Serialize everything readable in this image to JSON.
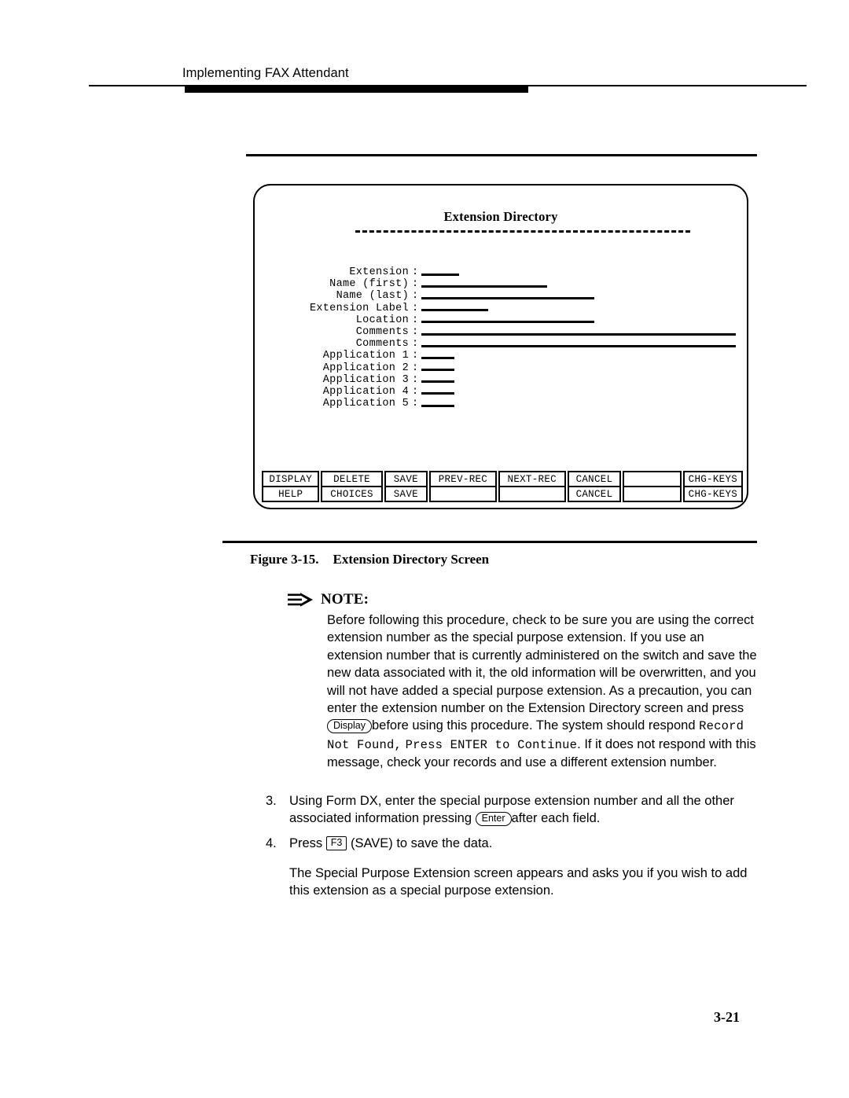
{
  "header": {
    "running_title": "Implementing FAX Attendant"
  },
  "figure": {
    "screen": {
      "title": "Extension Directory",
      "fields": [
        {
          "label": "Extension",
          "colon": ":",
          "line_width": 48
        },
        {
          "label": "Name (first)",
          "colon": ":",
          "line_width": 160
        },
        {
          "label": "Name (last)",
          "colon": ":",
          "line_width": 220
        },
        {
          "label": "Extension Label",
          "colon": ":",
          "line_width": 85
        },
        {
          "label": "Location",
          "colon": ":",
          "line_width": 220
        },
        {
          "label": "Comments",
          "colon": ":",
          "line_width": 400
        },
        {
          "label": "Comments",
          "colon": ":",
          "line_width": 400
        },
        {
          "label": "Application 1",
          "colon": ":",
          "line_width": 42
        },
        {
          "label": "Application 2",
          "colon": ":",
          "line_width": 42
        },
        {
          "label": "Application 3",
          "colon": ":",
          "line_width": 42
        },
        {
          "label": "Application 4",
          "colon": ":",
          "line_width": 42
        },
        {
          "label": "Application 5",
          "colon": ":",
          "line_width": 42
        }
      ],
      "function_keys": {
        "row1": [
          "DISPLAY",
          "DELETE",
          "SAVE",
          "PREV-REC",
          "NEXT-REC",
          "CANCEL",
          "",
          "CHG-KEYS"
        ],
        "row2": [
          "HELP",
          "CHOICES",
          "SAVE",
          "",
          "",
          "CANCEL",
          "",
          "CHG-KEYS"
        ]
      }
    },
    "caption_number": "Figure 3-15.",
    "caption_title": "Extension Directory Screen"
  },
  "note": {
    "label": "NOTE:",
    "icon": "arrow-right-icon",
    "para1_a": "Before following this procedure, check to be sure you are using the correct extension number as the special purpose extension.  If you use an extension number that is currently administered on the switch and save the new data associated with it, the old information will be overwritten, and you will not have added a special purpose extension.  As a precaution, you can enter the extension number on the Extension Directory screen and press ",
    "key_display": "Display",
    "para1_b": "before using this procedure.  The system should respond ",
    "system_msg_1": "Record Not Found,",
    "system_msg_2": "Press ENTER to Continue",
    "para1_c": ". If it does not respond with this message, check your records and use a different extension number."
  },
  "steps": [
    {
      "number": "3.",
      "text_a": "Using Form DX, enter the special purpose extension number and all the other associated information pressing ",
      "key": "Enter",
      "key_style": "round",
      "text_b": "after each field."
    },
    {
      "number": "4.",
      "text_a": "Press ",
      "key": "F3",
      "key_style": "square",
      "text_b": " (SAVE) to save the data."
    }
  ],
  "closing_paragraph": "The Special Purpose Extension screen appears and asks you if you wish to add this extension as a special purpose extension.",
  "page_number": "3-21"
}
